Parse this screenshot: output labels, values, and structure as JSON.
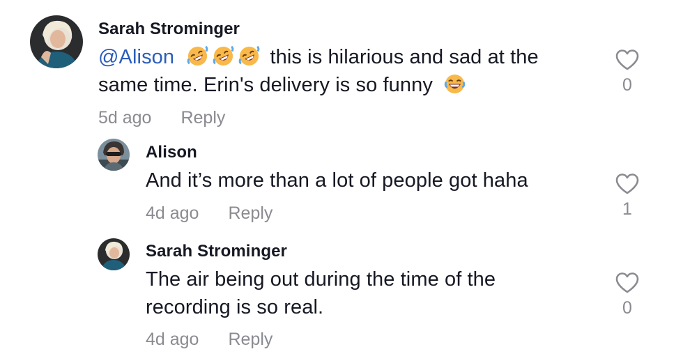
{
  "comments": [
    {
      "username": "Sarah Strominger",
      "mention": "@Alison",
      "text_after_emojis": "this is hilarious and sad at the",
      "text_line2": "same time. Erin's delivery is so funny",
      "emojis": [
        "rofl-emoji",
        "rofl-emoji",
        "rofl-emoji",
        "laughing-emoji"
      ],
      "time": "5d ago",
      "reply_label": "Reply",
      "likes": "0"
    },
    {
      "username": "Alison",
      "text": "And it’s more than a lot of people got haha",
      "time": "4d ago",
      "reply_label": "Reply",
      "likes": "1"
    },
    {
      "username": "Sarah Strominger",
      "text_line1": "The air being out during the time of the",
      "text_line2": "recording is so real.",
      "time": "4d ago",
      "reply_label": "Reply",
      "likes": "0"
    }
  ],
  "colors": {
    "text": "#161823",
    "mention": "#2b5db9",
    "secondary": "#8a8b91"
  }
}
